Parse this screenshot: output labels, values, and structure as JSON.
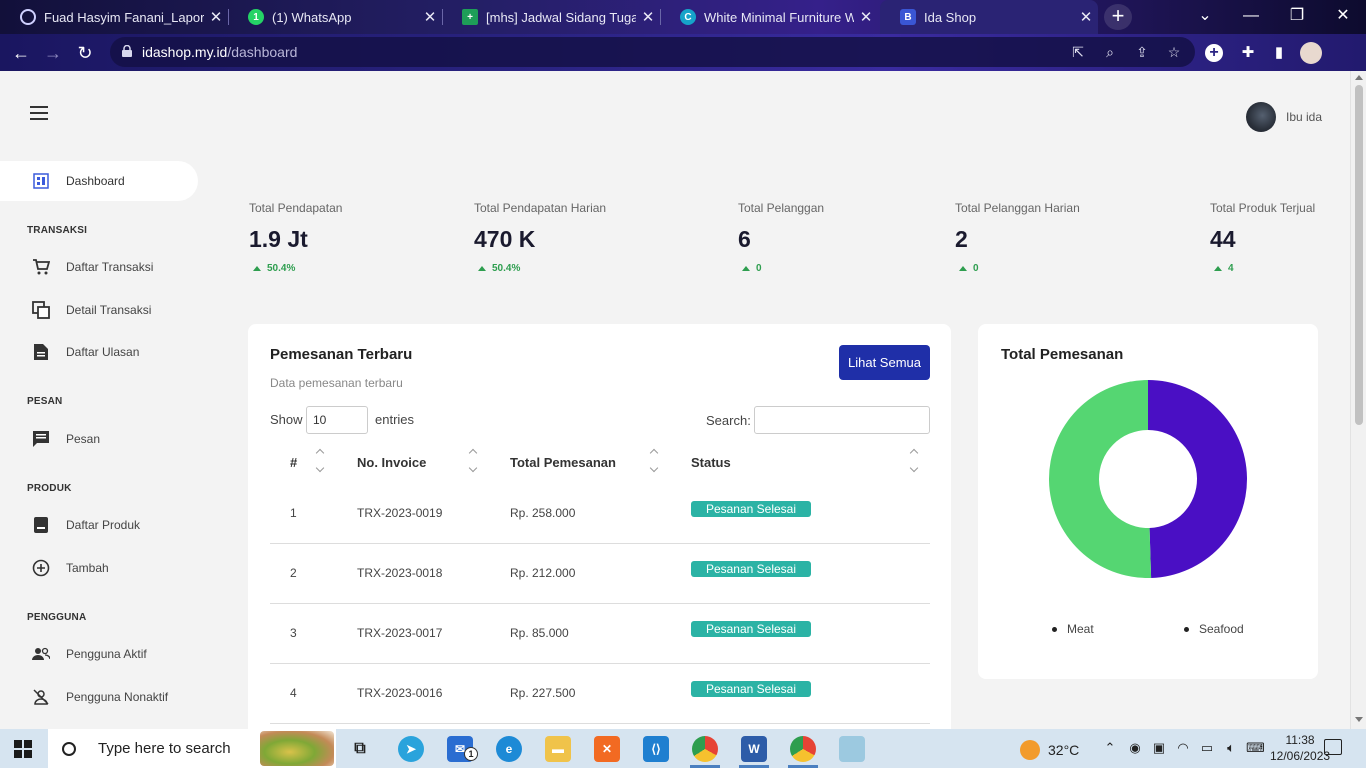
{
  "browser": {
    "tabs": [
      {
        "title": "Fuad Hasyim Fanani_Laporan",
        "active": false
      },
      {
        "title": "(1) WhatsApp",
        "active": false
      },
      {
        "title": "[mhs] Jadwal Sidang Tugas A",
        "active": false
      },
      {
        "title": "White Minimal Furniture Web",
        "active": false
      },
      {
        "title": "Ida Shop",
        "active": true
      }
    ],
    "url_host": "idashop.my.id",
    "url_path": "/dashboard"
  },
  "header": {
    "username": "Ibu ida"
  },
  "sidebar": {
    "dashboard": "Dashboard",
    "sections": [
      {
        "heading": "TRANSAKSI",
        "items": [
          "Daftar Transaksi",
          "Detail Transaksi",
          "Daftar Ulasan"
        ]
      },
      {
        "heading": "PESAN",
        "items": [
          "Pesan"
        ]
      },
      {
        "heading": "PRODUK",
        "items": [
          "Daftar Produk",
          "Tambah"
        ]
      },
      {
        "heading": "PENGGUNA",
        "items": [
          "Pengguna Aktif",
          "Pengguna Nonaktif"
        ]
      }
    ]
  },
  "stats": [
    {
      "label": "Total Pendapatan",
      "value": "1.9 Jt",
      "change": "50.4%"
    },
    {
      "label": "Total Pendapatan Harian",
      "value": "470 K",
      "change": "50.4%"
    },
    {
      "label": "Total Pelanggan",
      "value": "6",
      "change": "0"
    },
    {
      "label": "Total Pelanggan Harian",
      "value": "2",
      "change": "0"
    },
    {
      "label": "Total Produk Terjual",
      "value": "44",
      "change": "4"
    }
  ],
  "orders": {
    "title": "Pemesanan Terbaru",
    "subtitle": "Data pemesanan terbaru",
    "see_all": "Lihat Semua",
    "show_label": "Show",
    "show_value": "10",
    "entries_label": "entries",
    "search_label": "Search:",
    "columns": [
      "#",
      "No. Invoice",
      "Total Pemesanan",
      "Status"
    ],
    "rows": [
      {
        "no": "1",
        "invoice": "TRX-2023-0019",
        "total": "Rp. 258.000",
        "status": "Pesanan Selesai"
      },
      {
        "no": "2",
        "invoice": "TRX-2023-0018",
        "total": "Rp. 212.000",
        "status": "Pesanan Selesai"
      },
      {
        "no": "3",
        "invoice": "TRX-2023-0017",
        "total": "Rp. 85.000",
        "status": "Pesanan Selesai"
      },
      {
        "no": "4",
        "invoice": "TRX-2023-0016",
        "total": "Rp. 227.500",
        "status": "Pesanan Selesai"
      }
    ]
  },
  "donut": {
    "title": "Total Pemesanan"
  },
  "chart_data": {
    "type": "pie",
    "title": "Total Pemesanan",
    "categories": [
      "Meat",
      "Seafood"
    ],
    "values": [
      50.5,
      49.5
    ],
    "colors": [
      "#55d672",
      "#4a0fc4"
    ],
    "legend": "bottom"
  },
  "taskbar": {
    "search_placeholder": "Type here to search",
    "temperature": "32°C",
    "time": "11:38",
    "date": "12/06/2023",
    "mail_badge": "1"
  },
  "colors": {
    "primary_button": "#1f2fa8",
    "badge": "#2bb3a5",
    "stat_up": "#2e9e4f"
  }
}
